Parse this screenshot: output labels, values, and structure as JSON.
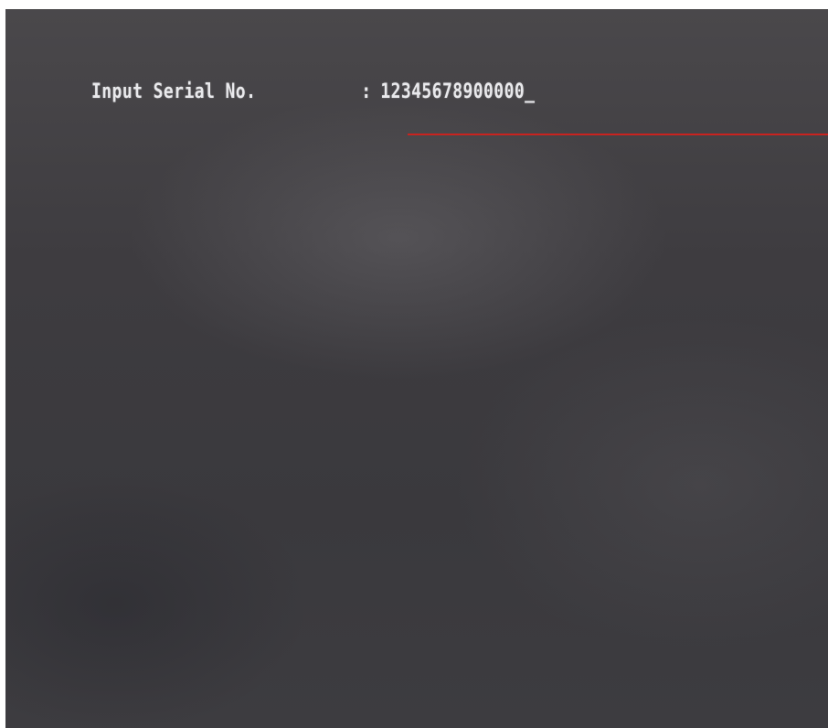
{
  "prompt": {
    "label": "Input Serial No.",
    "separator": ":",
    "value": "12345678900000",
    "cursor": "_"
  },
  "colors": {
    "screen_background": "#3e3c40",
    "text": "#e9e9ec",
    "underline": "#c9231f"
  }
}
